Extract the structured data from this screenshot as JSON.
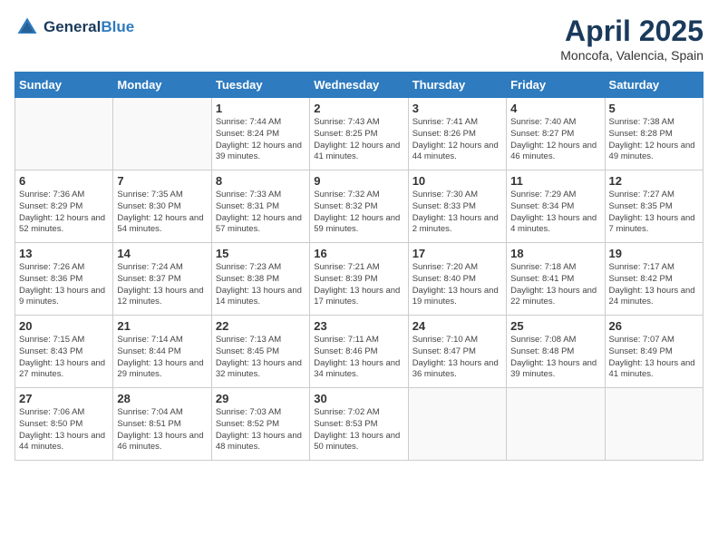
{
  "header": {
    "logo_general": "General",
    "logo_blue": "Blue",
    "month_title": "April 2025",
    "location": "Moncofa, Valencia, Spain"
  },
  "weekdays": [
    "Sunday",
    "Monday",
    "Tuesday",
    "Wednesday",
    "Thursday",
    "Friday",
    "Saturday"
  ],
  "weeks": [
    [
      {
        "day": null,
        "sunrise": null,
        "sunset": null,
        "daylight": null
      },
      {
        "day": null,
        "sunrise": null,
        "sunset": null,
        "daylight": null
      },
      {
        "day": "1",
        "sunrise": "Sunrise: 7:44 AM",
        "sunset": "Sunset: 8:24 PM",
        "daylight": "Daylight: 12 hours and 39 minutes."
      },
      {
        "day": "2",
        "sunrise": "Sunrise: 7:43 AM",
        "sunset": "Sunset: 8:25 PM",
        "daylight": "Daylight: 12 hours and 41 minutes."
      },
      {
        "day": "3",
        "sunrise": "Sunrise: 7:41 AM",
        "sunset": "Sunset: 8:26 PM",
        "daylight": "Daylight: 12 hours and 44 minutes."
      },
      {
        "day": "4",
        "sunrise": "Sunrise: 7:40 AM",
        "sunset": "Sunset: 8:27 PM",
        "daylight": "Daylight: 12 hours and 46 minutes."
      },
      {
        "day": "5",
        "sunrise": "Sunrise: 7:38 AM",
        "sunset": "Sunset: 8:28 PM",
        "daylight": "Daylight: 12 hours and 49 minutes."
      }
    ],
    [
      {
        "day": "6",
        "sunrise": "Sunrise: 7:36 AM",
        "sunset": "Sunset: 8:29 PM",
        "daylight": "Daylight: 12 hours and 52 minutes."
      },
      {
        "day": "7",
        "sunrise": "Sunrise: 7:35 AM",
        "sunset": "Sunset: 8:30 PM",
        "daylight": "Daylight: 12 hours and 54 minutes."
      },
      {
        "day": "8",
        "sunrise": "Sunrise: 7:33 AM",
        "sunset": "Sunset: 8:31 PM",
        "daylight": "Daylight: 12 hours and 57 minutes."
      },
      {
        "day": "9",
        "sunrise": "Sunrise: 7:32 AM",
        "sunset": "Sunset: 8:32 PM",
        "daylight": "Daylight: 12 hours and 59 minutes."
      },
      {
        "day": "10",
        "sunrise": "Sunrise: 7:30 AM",
        "sunset": "Sunset: 8:33 PM",
        "daylight": "Daylight: 13 hours and 2 minutes."
      },
      {
        "day": "11",
        "sunrise": "Sunrise: 7:29 AM",
        "sunset": "Sunset: 8:34 PM",
        "daylight": "Daylight: 13 hours and 4 minutes."
      },
      {
        "day": "12",
        "sunrise": "Sunrise: 7:27 AM",
        "sunset": "Sunset: 8:35 PM",
        "daylight": "Daylight: 13 hours and 7 minutes."
      }
    ],
    [
      {
        "day": "13",
        "sunrise": "Sunrise: 7:26 AM",
        "sunset": "Sunset: 8:36 PM",
        "daylight": "Daylight: 13 hours and 9 minutes."
      },
      {
        "day": "14",
        "sunrise": "Sunrise: 7:24 AM",
        "sunset": "Sunset: 8:37 PM",
        "daylight": "Daylight: 13 hours and 12 minutes."
      },
      {
        "day": "15",
        "sunrise": "Sunrise: 7:23 AM",
        "sunset": "Sunset: 8:38 PM",
        "daylight": "Daylight: 13 hours and 14 minutes."
      },
      {
        "day": "16",
        "sunrise": "Sunrise: 7:21 AM",
        "sunset": "Sunset: 8:39 PM",
        "daylight": "Daylight: 13 hours and 17 minutes."
      },
      {
        "day": "17",
        "sunrise": "Sunrise: 7:20 AM",
        "sunset": "Sunset: 8:40 PM",
        "daylight": "Daylight: 13 hours and 19 minutes."
      },
      {
        "day": "18",
        "sunrise": "Sunrise: 7:18 AM",
        "sunset": "Sunset: 8:41 PM",
        "daylight": "Daylight: 13 hours and 22 minutes."
      },
      {
        "day": "19",
        "sunrise": "Sunrise: 7:17 AM",
        "sunset": "Sunset: 8:42 PM",
        "daylight": "Daylight: 13 hours and 24 minutes."
      }
    ],
    [
      {
        "day": "20",
        "sunrise": "Sunrise: 7:15 AM",
        "sunset": "Sunset: 8:43 PM",
        "daylight": "Daylight: 13 hours and 27 minutes."
      },
      {
        "day": "21",
        "sunrise": "Sunrise: 7:14 AM",
        "sunset": "Sunset: 8:44 PM",
        "daylight": "Daylight: 13 hours and 29 minutes."
      },
      {
        "day": "22",
        "sunrise": "Sunrise: 7:13 AM",
        "sunset": "Sunset: 8:45 PM",
        "daylight": "Daylight: 13 hours and 32 minutes."
      },
      {
        "day": "23",
        "sunrise": "Sunrise: 7:11 AM",
        "sunset": "Sunset: 8:46 PM",
        "daylight": "Daylight: 13 hours and 34 minutes."
      },
      {
        "day": "24",
        "sunrise": "Sunrise: 7:10 AM",
        "sunset": "Sunset: 8:47 PM",
        "daylight": "Daylight: 13 hours and 36 minutes."
      },
      {
        "day": "25",
        "sunrise": "Sunrise: 7:08 AM",
        "sunset": "Sunset: 8:48 PM",
        "daylight": "Daylight: 13 hours and 39 minutes."
      },
      {
        "day": "26",
        "sunrise": "Sunrise: 7:07 AM",
        "sunset": "Sunset: 8:49 PM",
        "daylight": "Daylight: 13 hours and 41 minutes."
      }
    ],
    [
      {
        "day": "27",
        "sunrise": "Sunrise: 7:06 AM",
        "sunset": "Sunset: 8:50 PM",
        "daylight": "Daylight: 13 hours and 44 minutes."
      },
      {
        "day": "28",
        "sunrise": "Sunrise: 7:04 AM",
        "sunset": "Sunset: 8:51 PM",
        "daylight": "Daylight: 13 hours and 46 minutes."
      },
      {
        "day": "29",
        "sunrise": "Sunrise: 7:03 AM",
        "sunset": "Sunset: 8:52 PM",
        "daylight": "Daylight: 13 hours and 48 minutes."
      },
      {
        "day": "30",
        "sunrise": "Sunrise: 7:02 AM",
        "sunset": "Sunset: 8:53 PM",
        "daylight": "Daylight: 13 hours and 50 minutes."
      },
      {
        "day": null,
        "sunrise": null,
        "sunset": null,
        "daylight": null
      },
      {
        "day": null,
        "sunrise": null,
        "sunset": null,
        "daylight": null
      },
      {
        "day": null,
        "sunrise": null,
        "sunset": null,
        "daylight": null
      }
    ]
  ]
}
